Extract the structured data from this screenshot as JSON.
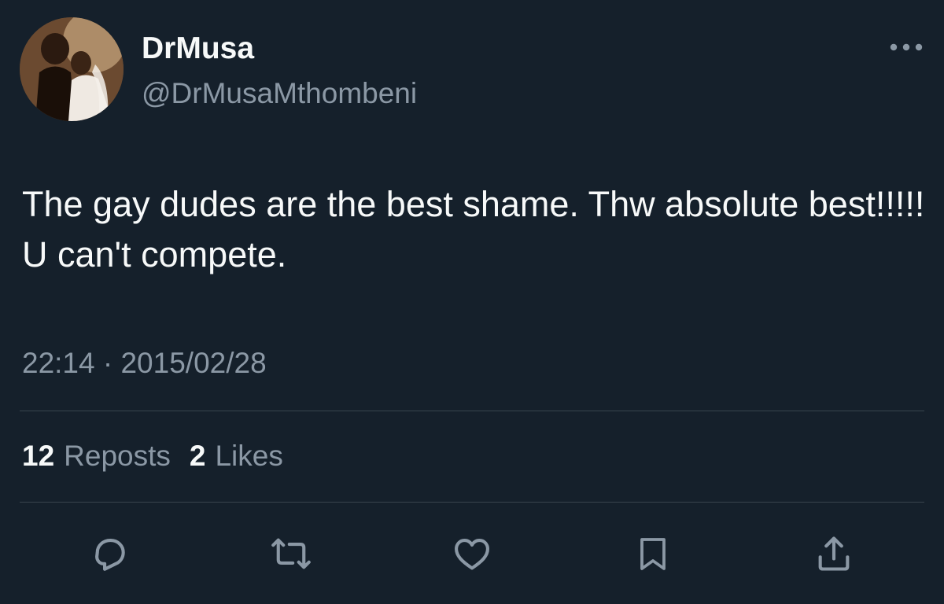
{
  "author": {
    "display_name": "DrMusa",
    "handle": "@DrMusaMthombeni",
    "avatar_icon": "profile-photo"
  },
  "tweet": {
    "text": "The gay dudes are the best shame. Thw absolute best!!!!! U can't compete.",
    "time": "22:14",
    "separator": "·",
    "date": "2015/02/28"
  },
  "stats": {
    "reposts_count": "12",
    "reposts_label": "Reposts",
    "likes_count": "2",
    "likes_label": "Likes"
  },
  "actions": {
    "reply_icon": "reply-icon",
    "repost_icon": "repost-icon",
    "like_icon": "heart-icon",
    "bookmark_icon": "bookmark-icon",
    "share_icon": "share-icon"
  },
  "colors": {
    "background": "#15202b",
    "primary_text": "#f7f9f9",
    "secondary_text": "#8b98a5",
    "divider": "#38444d"
  }
}
